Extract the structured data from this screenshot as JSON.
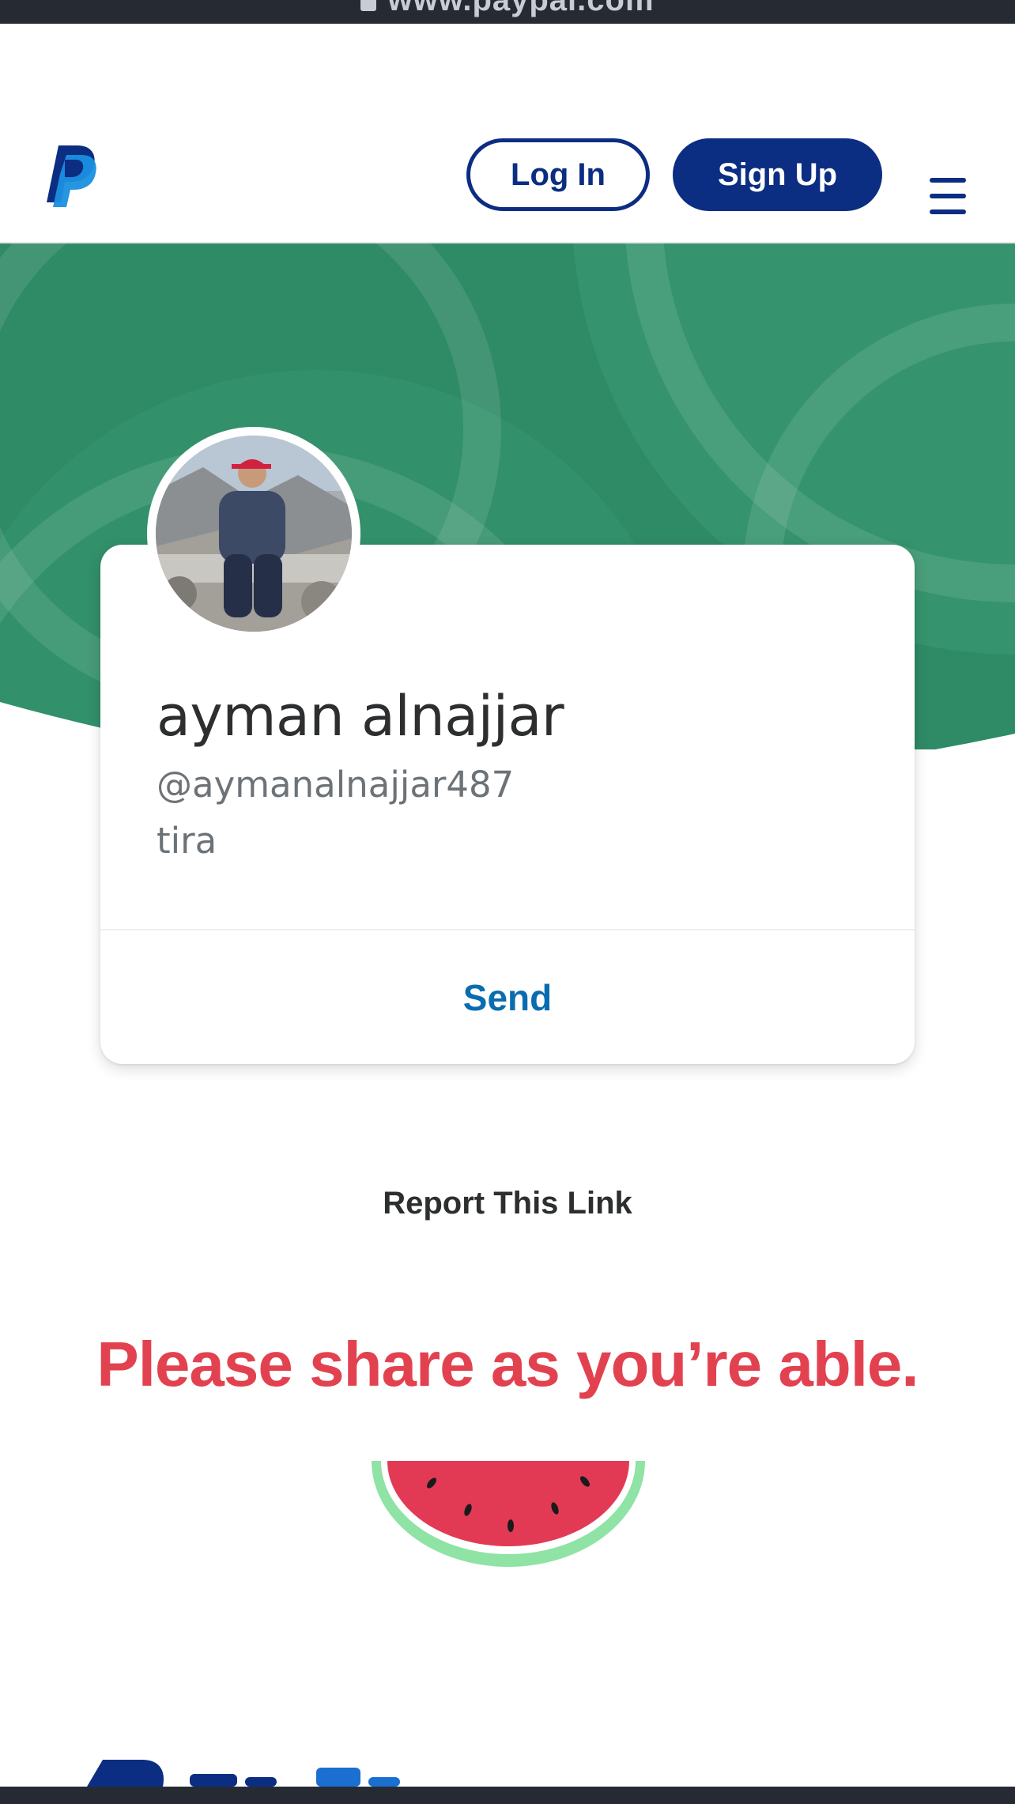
{
  "browser": {
    "url": "www.paypal.com"
  },
  "header": {
    "logo": "paypal-logo",
    "login_label": "Log In",
    "signup_label": "Sign Up",
    "menu_icon": "hamburger-menu-icon"
  },
  "profile": {
    "name": "ayman alnajjar",
    "handle": "@aymanalnajjar487",
    "note": "tira",
    "send_label": "Send"
  },
  "report_label": "Report This Link",
  "banner": {
    "text": "Please share as you’re able.",
    "icon": "watermelon-icon"
  },
  "colors": {
    "brand_navy": "#0b2d82",
    "brand_blue": "#0a6cb0",
    "hero_green": "#2f8a66",
    "share_red": "#e2424f",
    "watermelon_rind": "#8ee3a5"
  }
}
